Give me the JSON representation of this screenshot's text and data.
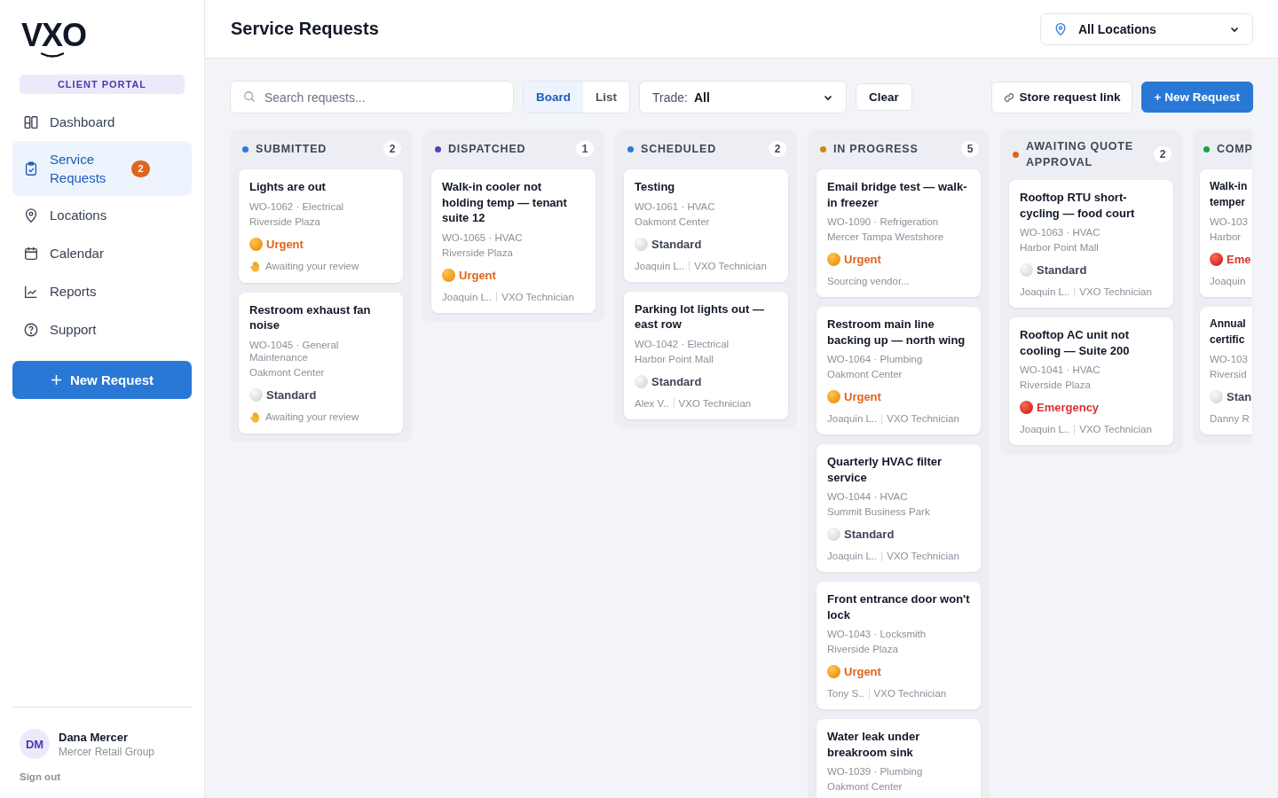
{
  "sidebar": {
    "logo": "VXO",
    "portal_label": "CLIENT PORTAL",
    "items": [
      {
        "label": "Dashboard",
        "selected": false
      },
      {
        "label": "Service Requests",
        "selected": true,
        "badge": "2"
      },
      {
        "label": "Locations",
        "selected": false
      },
      {
        "label": "Calendar",
        "selected": false
      },
      {
        "label": "Reports",
        "selected": false
      },
      {
        "label": "Support",
        "selected": false
      }
    ],
    "new_button": "New Request",
    "user": {
      "initials": "DM",
      "name": "Dana Mercer",
      "company": "Mercer Retail Group"
    },
    "sign_out": "Sign out"
  },
  "header": {
    "title": "Service Requests",
    "location_select": "All Locations"
  },
  "toolbar": {
    "search": {
      "placeholder": "Search requests..."
    },
    "views": [
      {
        "label": "Board",
        "selected": true
      },
      {
        "label": "List",
        "selected": false
      }
    ],
    "trade_label": "Trade:",
    "trade_value": "All",
    "clear": "Clear",
    "store_link": "Store request link",
    "new_request": "+ New Request"
  },
  "columns": [
    {
      "title": "SUBMITTED",
      "color": "#2f7bd8",
      "count": "2",
      "cards": [
        {
          "title": "Lights are out",
          "meta": "WO-1062 · Electrical",
          "location": "Riverside Plaza",
          "priority": {
            "kind": "urgent",
            "label": "Urgent"
          },
          "footer": {
            "kind": "review",
            "text": "Awaiting your review"
          }
        },
        {
          "title": "Restroom exhaust fan noise",
          "meta": "WO-1045 · General Maintenance",
          "location": "Oakmont Center",
          "priority": {
            "kind": "standard",
            "label": "Standard"
          },
          "footer": {
            "kind": "review",
            "text": "Awaiting your review"
          }
        }
      ]
    },
    {
      "title": "DISPATCHED",
      "color": "#5b3fb5",
      "count": "1",
      "cards": [
        {
          "title": "Walk-in cooler not holding temp — tenant suite 12",
          "meta": "WO-1065 · HVAC",
          "location": "Riverside Plaza",
          "priority": {
            "kind": "urgent",
            "label": "Urgent"
          },
          "footer": {
            "kind": "assignee",
            "name": "Joaquin L..",
            "role": "VXO Technician"
          }
        }
      ]
    },
    {
      "title": "SCHEDULED",
      "color": "#2f7bd8",
      "count": "2",
      "cards": [
        {
          "title": "Testing",
          "meta": "WO-1061 · HVAC",
          "location": "Oakmont Center",
          "priority": {
            "kind": "standard",
            "label": "Standard"
          },
          "footer": {
            "kind": "assignee",
            "name": "Joaquin L..",
            "role": "VXO Technician"
          }
        },
        {
          "title": "Parking lot lights out — east row",
          "meta": "WO-1042 · Electrical",
          "location": "Harbor Point Mall",
          "priority": {
            "kind": "standard",
            "label": "Standard"
          },
          "footer": {
            "kind": "assignee",
            "name": "Alex V..",
            "role": "VXO Technician"
          }
        }
      ]
    },
    {
      "title": "IN PROGRESS",
      "color": "#d4870c",
      "count": "5",
      "cards": [
        {
          "title": "Email bridge test — walk-in freezer",
          "meta": "WO-1090 · Refrigeration",
          "location": "Mercer Tampa Westshore",
          "priority": {
            "kind": "urgent",
            "label": "Urgent"
          },
          "footer": {
            "kind": "status",
            "text": "Sourcing vendor..."
          }
        },
        {
          "title": "Restroom main line backing up — north wing",
          "meta": "WO-1064 · Plumbing",
          "location": "Oakmont Center",
          "priority": {
            "kind": "urgent",
            "label": "Urgent"
          },
          "footer": {
            "kind": "assignee",
            "name": "Joaquin L..",
            "role": "VXO Technician"
          }
        },
        {
          "title": "Quarterly HVAC filter service",
          "meta": "WO-1044 · HVAC",
          "location": "Summit Business Park",
          "priority": {
            "kind": "standard",
            "label": "Standard"
          },
          "footer": {
            "kind": "assignee",
            "name": "Joaquin L..",
            "role": "VXO Technician"
          }
        },
        {
          "title": "Front entrance door won't lock",
          "meta": "WO-1043 · Locksmith",
          "location": "Riverside Plaza",
          "priority": {
            "kind": "urgent",
            "label": "Urgent"
          },
          "footer": {
            "kind": "assignee",
            "name": "Tony S..",
            "role": "VXO Technician"
          }
        },
        {
          "title": "Water leak under breakroom sink",
          "meta": "WO-1039 · Plumbing",
          "location": "Oakmont Center"
        }
      ]
    },
    {
      "title": "AWAITING QUOTE APPROVAL",
      "color": "#e0641c",
      "count": "2",
      "cards": [
        {
          "title": "Rooftop RTU short-cycling — food court",
          "meta": "WO-1063 · HVAC",
          "location": "Harbor Point Mall",
          "priority": {
            "kind": "standard",
            "label": "Standard"
          },
          "footer": {
            "kind": "assignee",
            "name": "Joaquin L..",
            "role": "VXO Technician"
          }
        },
        {
          "title": "Rooftop AC unit not cooling — Suite 200",
          "meta": "WO-1041 · HVAC",
          "location": "Riverside Plaza",
          "priority": {
            "kind": "emergency",
            "label": "Emergency"
          },
          "footer": {
            "kind": "assignee",
            "name": "Joaquin L..",
            "role": "VXO Technician"
          }
        }
      ]
    },
    {
      "title": "COMP",
      "color": "#1fa33a",
      "clipped": true,
      "cards": [
        {
          "title": "Walk-in temper",
          "meta": "WO-103",
          "location": "Harbor",
          "priority": {
            "kind": "emergency",
            "label": "Eme"
          },
          "footer": {
            "kind": "status",
            "text": "Joaquin"
          }
        },
        {
          "title": "Annual certific",
          "meta": "WO-103",
          "location": "Riversid",
          "priority": {
            "kind": "standard",
            "label": "Stan"
          },
          "footer": {
            "kind": "status",
            "text": "Danny R"
          }
        }
      ]
    }
  ]
}
